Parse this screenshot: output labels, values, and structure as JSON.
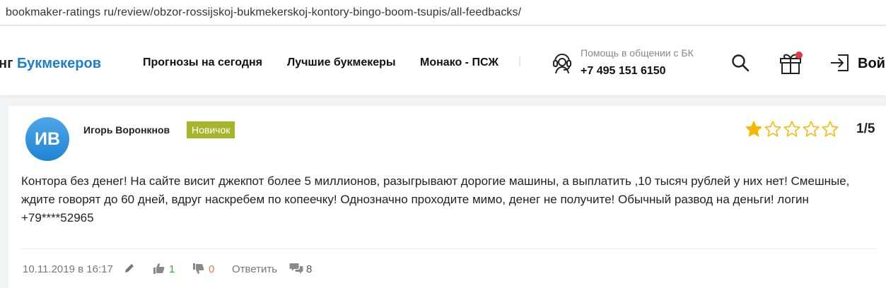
{
  "browser": {
    "url": "bookmaker-ratings ru/review/obzor-rossijskoj-bukmekerskoj-kontory-bingo-boom-tsupis/all-feedbacks/"
  },
  "header": {
    "logo_part1": "нг",
    "logo_part2": "Букмекеров",
    "nav": [
      "Прогнозы на сегодня",
      "Лучшие букмекеры",
      "Монако - ПСЖ"
    ],
    "help_label": "Помощь в общении с БК",
    "phone": "+7 495 151 6150",
    "login_label": "Вой",
    "icons": [
      "support-headset-icon",
      "search-icon",
      "gift-icon",
      "login-icon"
    ],
    "accent_color": "#1b7fce",
    "notification_dot_color": "#e0393e"
  },
  "review": {
    "avatar_initials": "ИВ",
    "author": "Игорь Воронкнов",
    "badge": "Новичок",
    "badge_color": "#a7b52d",
    "rating": 1,
    "rating_max": 5,
    "rating_label": "1/5",
    "star_color": "#f5b800",
    "text": "Контора без денег! На сайте висит джекпот более 5 миллионов, разыгрывают дорогие машины, а выплатить ,10 тысяч рублей у них нет! Смешные, ждите говорят до 60 дней, вдруг наскребем по копеечку! Однозначно проходите мимо, денег не получите! Обычный развод на деньги!  логин +79****52965",
    "date": "10.11.2019 в 16:17",
    "likes": "1",
    "dislikes": "0",
    "reply_label": "Ответить",
    "comments": "8"
  }
}
